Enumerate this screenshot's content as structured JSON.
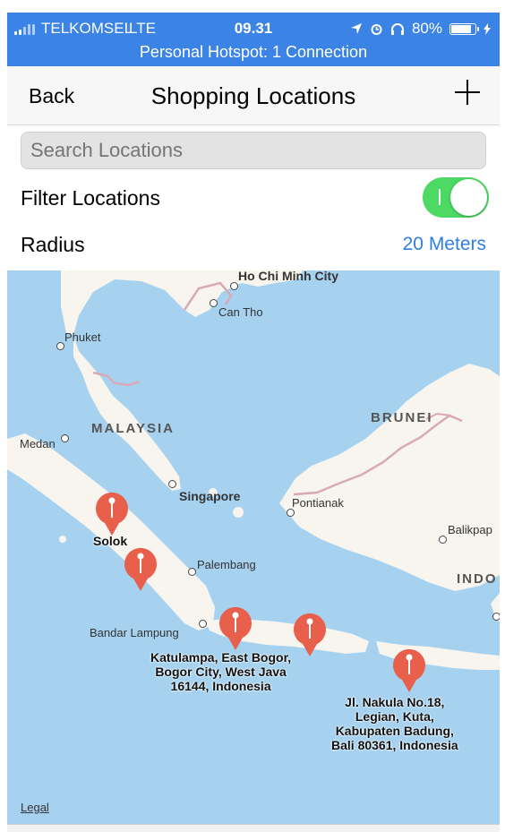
{
  "status_bar": {
    "carrier": "TELKOMSEL",
    "network": "LTE",
    "time": "09.31",
    "battery_percent": "80%",
    "battery_level": 0.8,
    "hotspot": "Personal Hotspot: 1 Connection"
  },
  "nav": {
    "back_label": "Back",
    "title": "Shopping Locations"
  },
  "search": {
    "placeholder": "Search Locations"
  },
  "filter": {
    "label": "Filter Locations",
    "enabled": true
  },
  "radius": {
    "label": "Radius",
    "value": "20 Meters"
  },
  "map": {
    "places": {
      "ho_chi_minh": "Ho Chi Minh City",
      "can_tho": "Can Tho",
      "phuket": "Phuket",
      "medan": "Medan",
      "singapore": "Singapore",
      "pontianak": "Pontianak",
      "balikpapan": "Balikpap",
      "palembang": "Palembang",
      "bandar_lampung": "Bandar Lampung"
    },
    "countries": {
      "malaysia": "MALAYSIA",
      "brunei": "BRUNEI",
      "indonesia": "INDO"
    },
    "pins": [
      {
        "label": "Solok"
      },
      {
        "label": ""
      },
      {
        "label": "Katulampa, East Bogor,\nBogor City, West Java\n16144, Indonesia"
      },
      {
        "label": ""
      },
      {
        "label": "Jl. Nakula No.18,\nLegian, Kuta,\nKabupaten Badung,\nBali 80361, Indonesia"
      }
    ],
    "legal": "Legal",
    "pin_color": "#e8604c",
    "water_color": "#a6d2f0",
    "land_color": "#f7f5ee"
  }
}
